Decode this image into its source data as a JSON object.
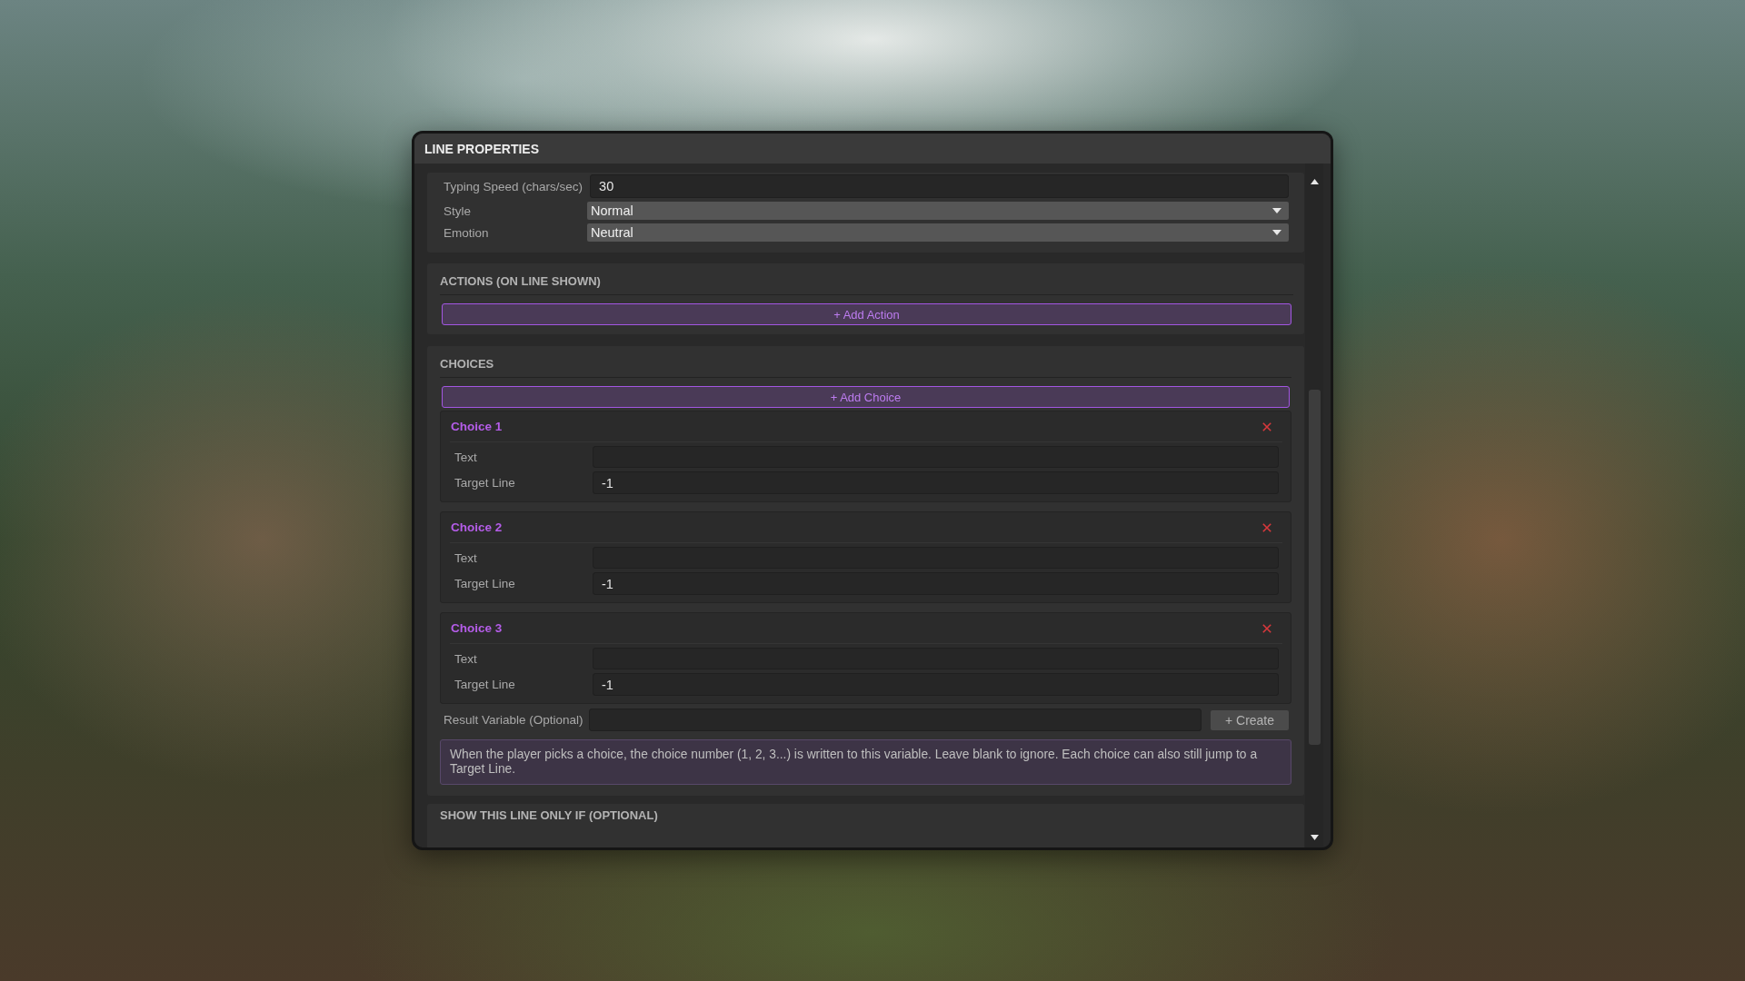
{
  "window": {
    "title": "LINE PROPERTIES"
  },
  "general": {
    "fields": [
      {
        "kind": "text",
        "label": "Typing Speed (chars/sec)",
        "value": "30"
      },
      {
        "kind": "dropdown",
        "label": "Style",
        "value": "Normal"
      },
      {
        "kind": "dropdown",
        "label": "Emotion",
        "value": "Neutral"
      }
    ]
  },
  "actions": {
    "title": "ACTIONS (ON LINE SHOWN)",
    "add_button": "+ Add Action"
  },
  "choices": {
    "title": "CHOICES",
    "add_button": "+ Add Choice",
    "items": [
      {
        "title": "Choice 1",
        "fields": [
          {
            "label": "Text"
          },
          {
            "label": "Target Line",
            "value": "-1"
          }
        ]
      },
      {
        "title": "Choice 2",
        "fields": [
          {
            "label": "Text"
          },
          {
            "label": "Target Line",
            "value": "-1"
          }
        ]
      },
      {
        "title": "Choice 3",
        "fields": [
          {
            "label": "Text"
          },
          {
            "label": "Target Line",
            "value": "-1"
          }
        ]
      }
    ],
    "result_variable": {
      "label": "Result Variable (Optional)",
      "create_button": "+ Create"
    },
    "note": "When the player picks a choice, the choice number (1, 2, 3...) is written to this variable. Leave blank to ignore. Each choice can also still jump to a Target Line."
  },
  "condition": {
    "title": "SHOW THIS LINE ONLY IF (OPTIONAL)"
  }
}
